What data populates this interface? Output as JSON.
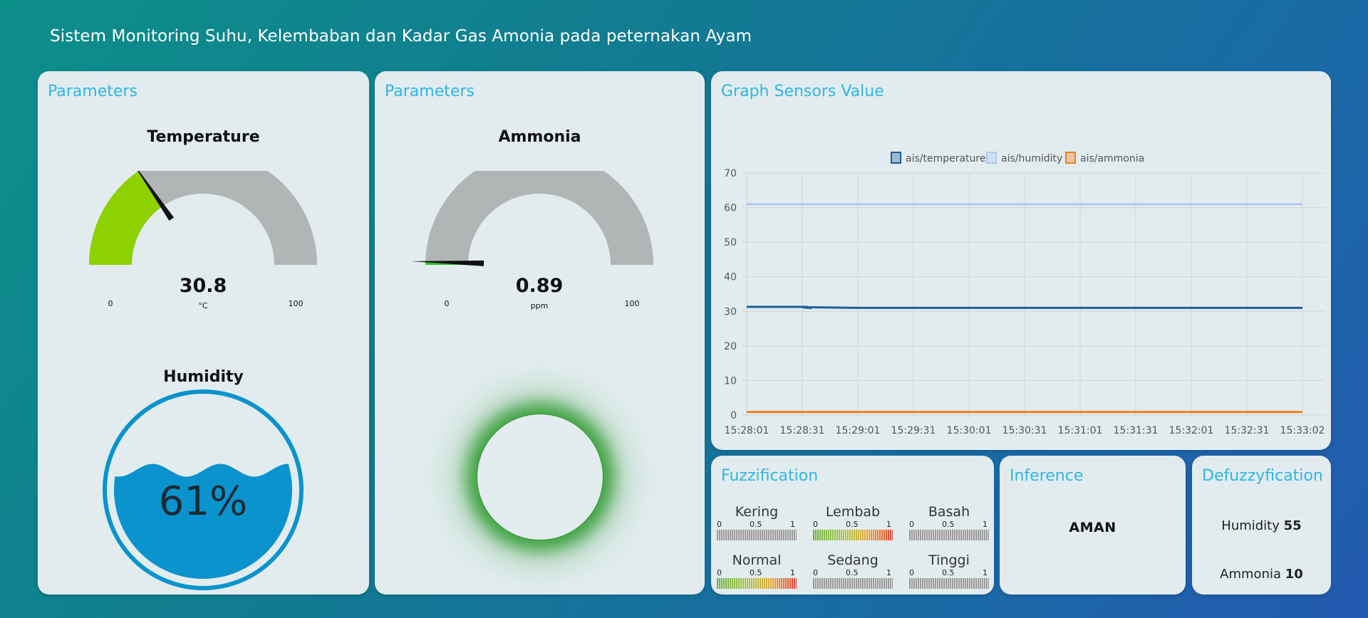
{
  "page": {
    "title": "Sistem Monitoring Suhu, Kelembaban dan Kadar Gas Amonia pada peternakan Ayam"
  },
  "panel_left": {
    "title": "Parameters",
    "temperature": {
      "label": "Temperature",
      "value": "30.8",
      "unit": "°C",
      "min": "0",
      "max": "100",
      "level": 0.308,
      "color": "#8ed100"
    },
    "humidity": {
      "label": "Humidity",
      "value": "61%",
      "level": 0.61,
      "color": "#0a93cd"
    }
  },
  "panel_middle": {
    "title": "Parameters",
    "ammonia": {
      "label": "Ammonia",
      "value": "0.89",
      "unit": "ppm",
      "min": "0",
      "max": "100",
      "level": 0.0089,
      "color": "#2ec02e"
    },
    "indicator": {
      "state": "green-glow",
      "color": "#2f9a2f"
    }
  },
  "graph": {
    "title": "Graph Sensors Value",
    "chart_data": {
      "type": "line",
      "x": [
        "15:28:01",
        "15:28:31",
        "15:29:01",
        "15:29:31",
        "15:30:01",
        "15:30:31",
        "15:31:01",
        "15:31:31",
        "15:32:01",
        "15:32:31",
        "15:33:02"
      ],
      "series": [
        {
          "name": "ais/temperature",
          "color": "#1c5f9c",
          "values": [
            31.3,
            31.2,
            31.0,
            31.0,
            31.0,
            31.0,
            31.0,
            31.0,
            31.0,
            31.0,
            31.0
          ]
        },
        {
          "name": "ais/humidity",
          "color": "#aec8ec",
          "values": [
            61,
            61,
            61,
            61,
            61,
            61,
            61,
            61,
            61,
            61,
            61
          ]
        },
        {
          "name": "ais/ammonia",
          "color": "#f07f1c",
          "values": [
            0.9,
            0.9,
            0.9,
            0.9,
            0.9,
            0.9,
            0.9,
            0.9,
            0.9,
            0.9,
            0.9
          ]
        }
      ],
      "yticks": [
        "0",
        "10",
        "20",
        "30",
        "40",
        "50",
        "60",
        "70"
      ],
      "ylim": [
        0,
        70
      ],
      "grid": true,
      "legend": "top"
    }
  },
  "fuzzification": {
    "title": "Fuzzification",
    "scale": [
      "0",
      "0.5",
      "1"
    ],
    "items": [
      {
        "label": "Kering",
        "style": "gray"
      },
      {
        "label": "Lembab",
        "style": "green-red"
      },
      {
        "label": "Basah",
        "style": "gray"
      },
      {
        "label": "Normal",
        "style": "green-red"
      },
      {
        "label": "Sedang",
        "style": "gray"
      },
      {
        "label": "Tinggi",
        "style": "gray"
      }
    ]
  },
  "inference": {
    "title": "Inference",
    "result": "AMAN"
  },
  "defuzzification": {
    "title": "Defuzzyfication",
    "humidity_label": "Humidity",
    "humidity_value": "55",
    "ammonia_label": "Ammonia",
    "ammonia_value": "10"
  }
}
